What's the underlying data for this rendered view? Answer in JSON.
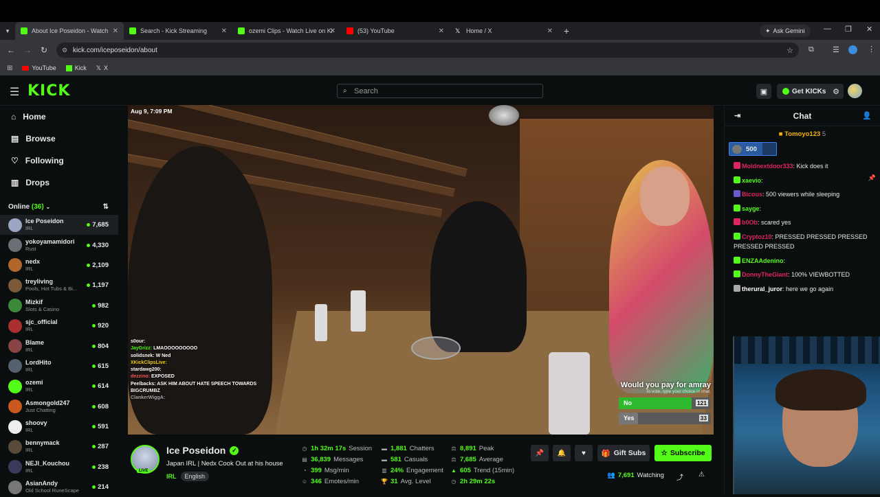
{
  "browser": {
    "tabs": [
      {
        "title": "About Ice Poseidon - Watch",
        "color": "#53fc18",
        "active": true
      },
      {
        "title": "Search - Kick Streaming",
        "color": "#53fc18",
        "active": false
      },
      {
        "title": "ozemi Clips - Watch Live on Ki",
        "color": "#53fc18",
        "active": false
      },
      {
        "title": "(53) YouTube",
        "color": "#ff0000",
        "active": false
      },
      {
        "title": "Home / X",
        "color": "#ffffff",
        "active": false
      }
    ],
    "ask_gemini": "Ask Gemini",
    "url": "kick.com/iceposeidon/about",
    "bookmarks": [
      "YouTube",
      "Kick",
      "X"
    ]
  },
  "header": {
    "logo": "KICK",
    "search_placeholder": "Search",
    "get_kicks": "Get KICKs"
  },
  "sidebar": {
    "nav": [
      {
        "label": "Home",
        "icon": "home-icon"
      },
      {
        "label": "Browse",
        "icon": "browse-icon"
      },
      {
        "label": "Following",
        "icon": "heart-icon"
      },
      {
        "label": "Drops",
        "icon": "drops-icon"
      }
    ],
    "online_label": "Online",
    "online_count": "(36)",
    "channels": [
      {
        "name": "Ice Poseidon",
        "category": "IRL",
        "viewers": "7,685",
        "color": "#9aa6c2"
      },
      {
        "name": "yokoyamamidori",
        "category": "Rust",
        "viewers": "4,330",
        "color": "#6b6f75"
      },
      {
        "name": "nedx",
        "category": "IRL",
        "viewers": "2,109",
        "color": "#b0662c"
      },
      {
        "name": "treyliving",
        "category": "Pools, Hot Tubs & Bi...",
        "viewers": "1,197",
        "color": "#7a5a3a"
      },
      {
        "name": "Mizkif",
        "category": "Slots & Casino",
        "viewers": "982",
        "color": "#3a8a3a"
      },
      {
        "name": "sjc_official",
        "category": "IRL",
        "viewers": "920",
        "color": "#aa3030"
      },
      {
        "name": "Blame",
        "category": "IRL",
        "viewers": "804",
        "color": "#884444"
      },
      {
        "name": "LordHito",
        "category": "IRL",
        "viewers": "615",
        "color": "#556070"
      },
      {
        "name": "ozemi",
        "category": "IRL",
        "viewers": "614",
        "color": "#53fc18"
      },
      {
        "name": "Asmongold247",
        "category": "Just Chatting",
        "viewers": "608",
        "color": "#c85a20"
      },
      {
        "name": "shoovy",
        "category": "IRL",
        "viewers": "591",
        "color": "#eeeeee"
      },
      {
        "name": "bennymack",
        "category": "IRL",
        "viewers": "287",
        "color": "#5a4a3a"
      },
      {
        "name": "NEJI_Kouchou",
        "category": "IRL",
        "viewers": "238",
        "color": "#3a3a5a"
      },
      {
        "name": "AsianAndy",
        "category": "Old School RuneScape",
        "viewers": "214",
        "color": "#777777"
      }
    ]
  },
  "video": {
    "timestamp": "Aug 9, 7:09 PM",
    "overlay_chat": [
      {
        "user": "s0our:",
        "text": "",
        "color": "#ffffff"
      },
      {
        "user": "JayGrizz:",
        "text": " LMAOOOOOOOOO",
        "color": "#53fc18"
      },
      {
        "user": "solidsnek:",
        "text": " W Ned",
        "color": "#ffffff"
      },
      {
        "user": "XKickClipsLive:",
        "text": "",
        "color": "#f5d20b"
      },
      {
        "user": "stardawg200:",
        "text": "",
        "color": "#ffffff"
      },
      {
        "user": "dezzino:",
        "text": " EXPOSED",
        "color": "#ff5c5c"
      },
      {
        "user": "Peelbacks:",
        "text": " ASK HIM ABOUT HATE SPEECH TOWARDS",
        "color": "#ffffff"
      },
      {
        "user": "BIGCRUMBZ",
        "text": "",
        "color": "#ffffff"
      },
      {
        "user": "ClankerWiggA:",
        "text": "",
        "color": "#aaaaaa"
      }
    ],
    "poll": {
      "question": "Would you pay for amray",
      "subtitle": "To vote, type your choice in chat.",
      "options": [
        {
          "label": "No",
          "count": "121",
          "fraction": 0.79,
          "color": "#2eb82e"
        },
        {
          "label": "Yes",
          "count": "33",
          "fraction": 0.21,
          "color": "#777777"
        }
      ]
    }
  },
  "channel": {
    "name": "Ice Poseidon",
    "title": "Japan IRL | Nedx Cook Out at his house",
    "category": "IRL",
    "language": "English",
    "live_badge": "LIVE",
    "stats": [
      {
        "value": "1h 32m 17s",
        "label": "Session",
        "icon": "clock-icon"
      },
      {
        "value": "36,839",
        "label": "Messages",
        "icon": "message-icon"
      },
      {
        "value": "399",
        "label": "Msg/min",
        "icon": "speed-icon"
      },
      {
        "value": "346",
        "label": "Emotes/min",
        "icon": "emote-icon"
      },
      {
        "value": "1,881",
        "label": "Chatters",
        "icon": "chatters-icon"
      },
      {
        "value": "581",
        "label": "Casuals",
        "icon": "casuals-icon"
      },
      {
        "value": "24%",
        "label": "Engagement",
        "icon": "engagement-icon"
      },
      {
        "value": "31",
        "label": "Avg. Level",
        "icon": "trophy-icon"
      },
      {
        "value": "8,891",
        "label": "Peak",
        "icon": "peak-icon"
      },
      {
        "value": "7,685",
        "label": "Average",
        "icon": "average-icon"
      },
      {
        "value": "605",
        "label": "Trend (15min)",
        "icon": "trend-icon"
      },
      {
        "value": "2h 29m 22s",
        "label": "",
        "icon": "timer-icon"
      }
    ],
    "gift_subs": "Gift Subs",
    "subscribe": "Subscribe",
    "watching_count": "7,691",
    "watching_label": "Watching"
  },
  "chat": {
    "title": "Chat",
    "gifter": "Tomoyo123",
    "gifter_count": "5",
    "goal": "500",
    "messages": [
      {
        "user": "Moldnextdoor333",
        "text": ": Kick does it",
        "color": "#e0245e"
      },
      {
        "user": "xaevio",
        "text": ":",
        "color": "#53fc18"
      },
      {
        "user": "Bicous",
        "text": ": 500 viewers while sleeping",
        "color": "#e0245e"
      },
      {
        "user": "sayge",
        "text": ":",
        "color": "#53fc18"
      },
      {
        "user": "b0Ob",
        "text": ": scared yes",
        "color": "#e0245e"
      },
      {
        "user": "Cryptoz10",
        "text": ": PRESSED  PRESSED  PRESSED  PRESSED PRESSED",
        "color": "#e0245e"
      },
      {
        "user": "ENZAAdenino",
        "text": ":",
        "color": "#53fc18"
      },
      {
        "user": "DonnyTheGiant",
        "text": ": 100% VIEWBOTTED",
        "color": "#e0245e"
      },
      {
        "user": "therural_juror",
        "text": ": here we go again",
        "color": "#ffffff"
      }
    ]
  }
}
